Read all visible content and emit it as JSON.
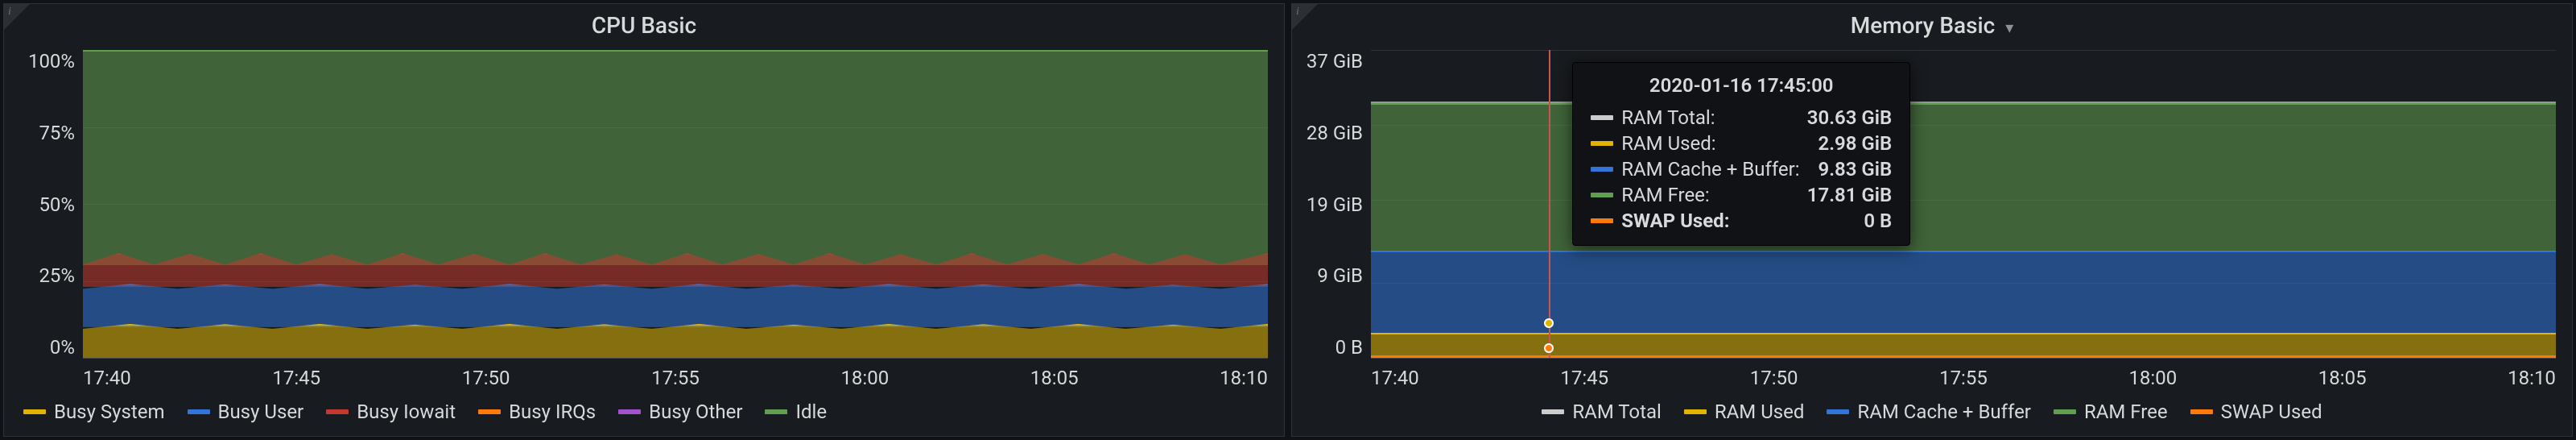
{
  "panels": {
    "cpu": {
      "title": "CPU Basic",
      "y_ticks": [
        "100%",
        "75%",
        "50%",
        "25%",
        "0%"
      ],
      "x_ticks": [
        "17:40",
        "17:45",
        "17:50",
        "17:55",
        "18:00",
        "18:05",
        "18:10"
      ],
      "legend": [
        {
          "name": "Busy System",
          "color": "#e0b400"
        },
        {
          "name": "Busy User",
          "color": "#3274d9"
        },
        {
          "name": "Busy Iowait",
          "color": "#c4382d"
        },
        {
          "name": "Busy IRQs",
          "color": "#ff780a"
        },
        {
          "name": "Busy Other",
          "color": "#a352cc"
        },
        {
          "name": "Idle",
          "color": "#629e51"
        }
      ]
    },
    "mem": {
      "title": "Memory Basic",
      "y_ticks": [
        "37 GiB",
        "28 GiB",
        "19 GiB",
        "9 GiB",
        "0 B"
      ],
      "x_ticks": [
        "17:40",
        "17:45",
        "17:50",
        "17:55",
        "18:00",
        "18:05",
        "18:10"
      ],
      "legend": [
        {
          "name": "RAM Total",
          "color": "#cccccc"
        },
        {
          "name": "RAM Used",
          "color": "#e0b400"
        },
        {
          "name": "RAM Cache + Buffer",
          "color": "#3274d9"
        },
        {
          "name": "RAM Free",
          "color": "#629e51"
        },
        {
          "name": "SWAP Used",
          "color": "#ff780a"
        }
      ],
      "tooltip": {
        "time": "2020-01-16 17:45:00",
        "rows": [
          {
            "name": "RAM Total:",
            "value": "30.63 GiB",
            "color": "#cccccc",
            "bold": false
          },
          {
            "name": "RAM Used:",
            "value": "2.98 GiB",
            "color": "#e0b400",
            "bold": false
          },
          {
            "name": "RAM Cache + Buffer:",
            "value": "9.83 GiB",
            "color": "#3274d9",
            "bold": false
          },
          {
            "name": "RAM Free:",
            "value": "17.81 GiB",
            "color": "#629e51",
            "bold": false
          },
          {
            "name": "SWAP Used:",
            "value": "0 B",
            "color": "#ff780a",
            "bold": true
          }
        ]
      }
    }
  },
  "chart_data": [
    {
      "type": "area",
      "title": "CPU Basic",
      "xlabel": "",
      "ylabel": "",
      "x": [
        "17:40",
        "17:45",
        "17:50",
        "17:55",
        "18:00",
        "18:05",
        "18:10"
      ],
      "ylim": [
        0,
        100
      ],
      "y_unit": "%",
      "stacked": true,
      "series": [
        {
          "name": "Busy System",
          "color": "#e0b400",
          "values": [
            10,
            10,
            10,
            10,
            10,
            10,
            10
          ]
        },
        {
          "name": "Busy User",
          "color": "#3274d9",
          "values": [
            13,
            13,
            13,
            13,
            13,
            13,
            13
          ]
        },
        {
          "name": "Busy Iowait",
          "color": "#c4382d",
          "values": [
            7,
            7,
            7,
            7,
            7,
            7,
            7
          ]
        },
        {
          "name": "Busy IRQs",
          "color": "#ff780a",
          "values": [
            0,
            0,
            0,
            0,
            0,
            0,
            0
          ]
        },
        {
          "name": "Busy Other",
          "color": "#a352cc",
          "values": [
            0,
            0,
            0,
            0,
            0,
            0,
            0
          ]
        },
        {
          "name": "Idle",
          "color": "#629e51",
          "values": [
            70,
            70,
            70,
            70,
            70,
            70,
            70
          ]
        }
      ]
    },
    {
      "type": "area",
      "title": "Memory Basic",
      "xlabel": "",
      "ylabel": "",
      "x": [
        "17:40",
        "17:45",
        "17:50",
        "17:55",
        "18:00",
        "18:05",
        "18:10"
      ],
      "ylim": [
        0,
        37
      ],
      "y_unit": "GiB",
      "stacked": true,
      "overlay_lines": [
        {
          "name": "RAM Total",
          "color": "#cccccc",
          "value": 30.63
        },
        {
          "name": "SWAP Used",
          "color": "#ff780a",
          "value": 0
        }
      ],
      "series": [
        {
          "name": "RAM Used",
          "color": "#e0b400",
          "values": [
            2.98,
            2.98,
            2.98,
            2.98,
            2.98,
            2.98,
            2.98
          ]
        },
        {
          "name": "RAM Cache + Buffer",
          "color": "#3274d9",
          "values": [
            9.83,
            9.83,
            9.83,
            9.83,
            9.83,
            9.83,
            9.83
          ]
        },
        {
          "name": "RAM Free",
          "color": "#629e51",
          "values": [
            17.81,
            17.81,
            17.81,
            17.81,
            17.81,
            17.81,
            17.81
          ]
        }
      ],
      "hover": {
        "x": "17:45",
        "timestamp": "2020-01-16 17:45:00",
        "values": {
          "RAM Total": "30.63 GiB",
          "RAM Used": "2.98 GiB",
          "RAM Cache + Buffer": "9.83 GiB",
          "RAM Free": "17.81 GiB",
          "SWAP Used": "0 B"
        }
      }
    }
  ]
}
